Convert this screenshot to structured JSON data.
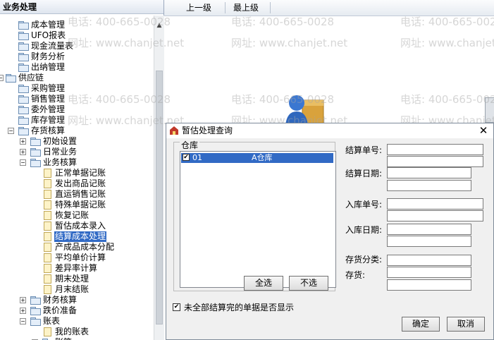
{
  "left_panel": {
    "title": "业务处理",
    "tree": [
      {
        "label": "成本管理"
      },
      {
        "label": "UFO报表"
      },
      {
        "label": "现金流量表"
      },
      {
        "label": "财务分析"
      },
      {
        "label": "出纳管理"
      },
      {
        "label": "供应链"
      },
      {
        "label": "采购管理"
      },
      {
        "label": "销售管理"
      },
      {
        "label": "委外管理"
      },
      {
        "label": "库存管理"
      },
      {
        "label": "存货核算"
      },
      {
        "label": "初始设置"
      },
      {
        "label": "日常业务"
      },
      {
        "label": "业务核算"
      },
      {
        "label": "正常单据记账"
      },
      {
        "label": "发出商品记账"
      },
      {
        "label": "直运销售记账"
      },
      {
        "label": "特殊单据记账"
      },
      {
        "label": "恢复记账"
      },
      {
        "label": "暂估成本录入"
      },
      {
        "label": "结算成本处理",
        "selected": true
      },
      {
        "label": "产成品成本分配"
      },
      {
        "label": "平均单价计算"
      },
      {
        "label": "差异率计算"
      },
      {
        "label": "期末处理"
      },
      {
        "label": "月末结账"
      },
      {
        "label": "财务核算"
      },
      {
        "label": "跌价准备"
      },
      {
        "label": "账表"
      },
      {
        "label": "我的账表"
      },
      {
        "label": "账簿"
      }
    ],
    "scroll_up_glyph": "▲"
  },
  "toolbar": {
    "up_level": "上一级",
    "top_level": "最上级"
  },
  "watermark": {
    "phone": "电话: 400-665-0028",
    "website": "网址: www.chanjet.net"
  },
  "dialog": {
    "title": "暂估处理查询",
    "close_glyph": "✕",
    "warehouse_group_label": "仓库",
    "warehouses": [
      {
        "code": "01",
        "name": "A仓库",
        "checked": true
      }
    ],
    "select_all": "全选",
    "deselect": "不选",
    "show_unsettled": "未全部结算完的单据是否显示",
    "show_unsettled_checked": true,
    "fields": {
      "settle_no": "结算单号:",
      "settle_date": "结算日期:",
      "inbound_no": "入库单号:",
      "inbound_date": "入库日期:",
      "inventory_category": "存货分类:",
      "inventory": "存货:"
    },
    "ok": "确定",
    "cancel": "取消",
    "check_glyph": "✔"
  }
}
